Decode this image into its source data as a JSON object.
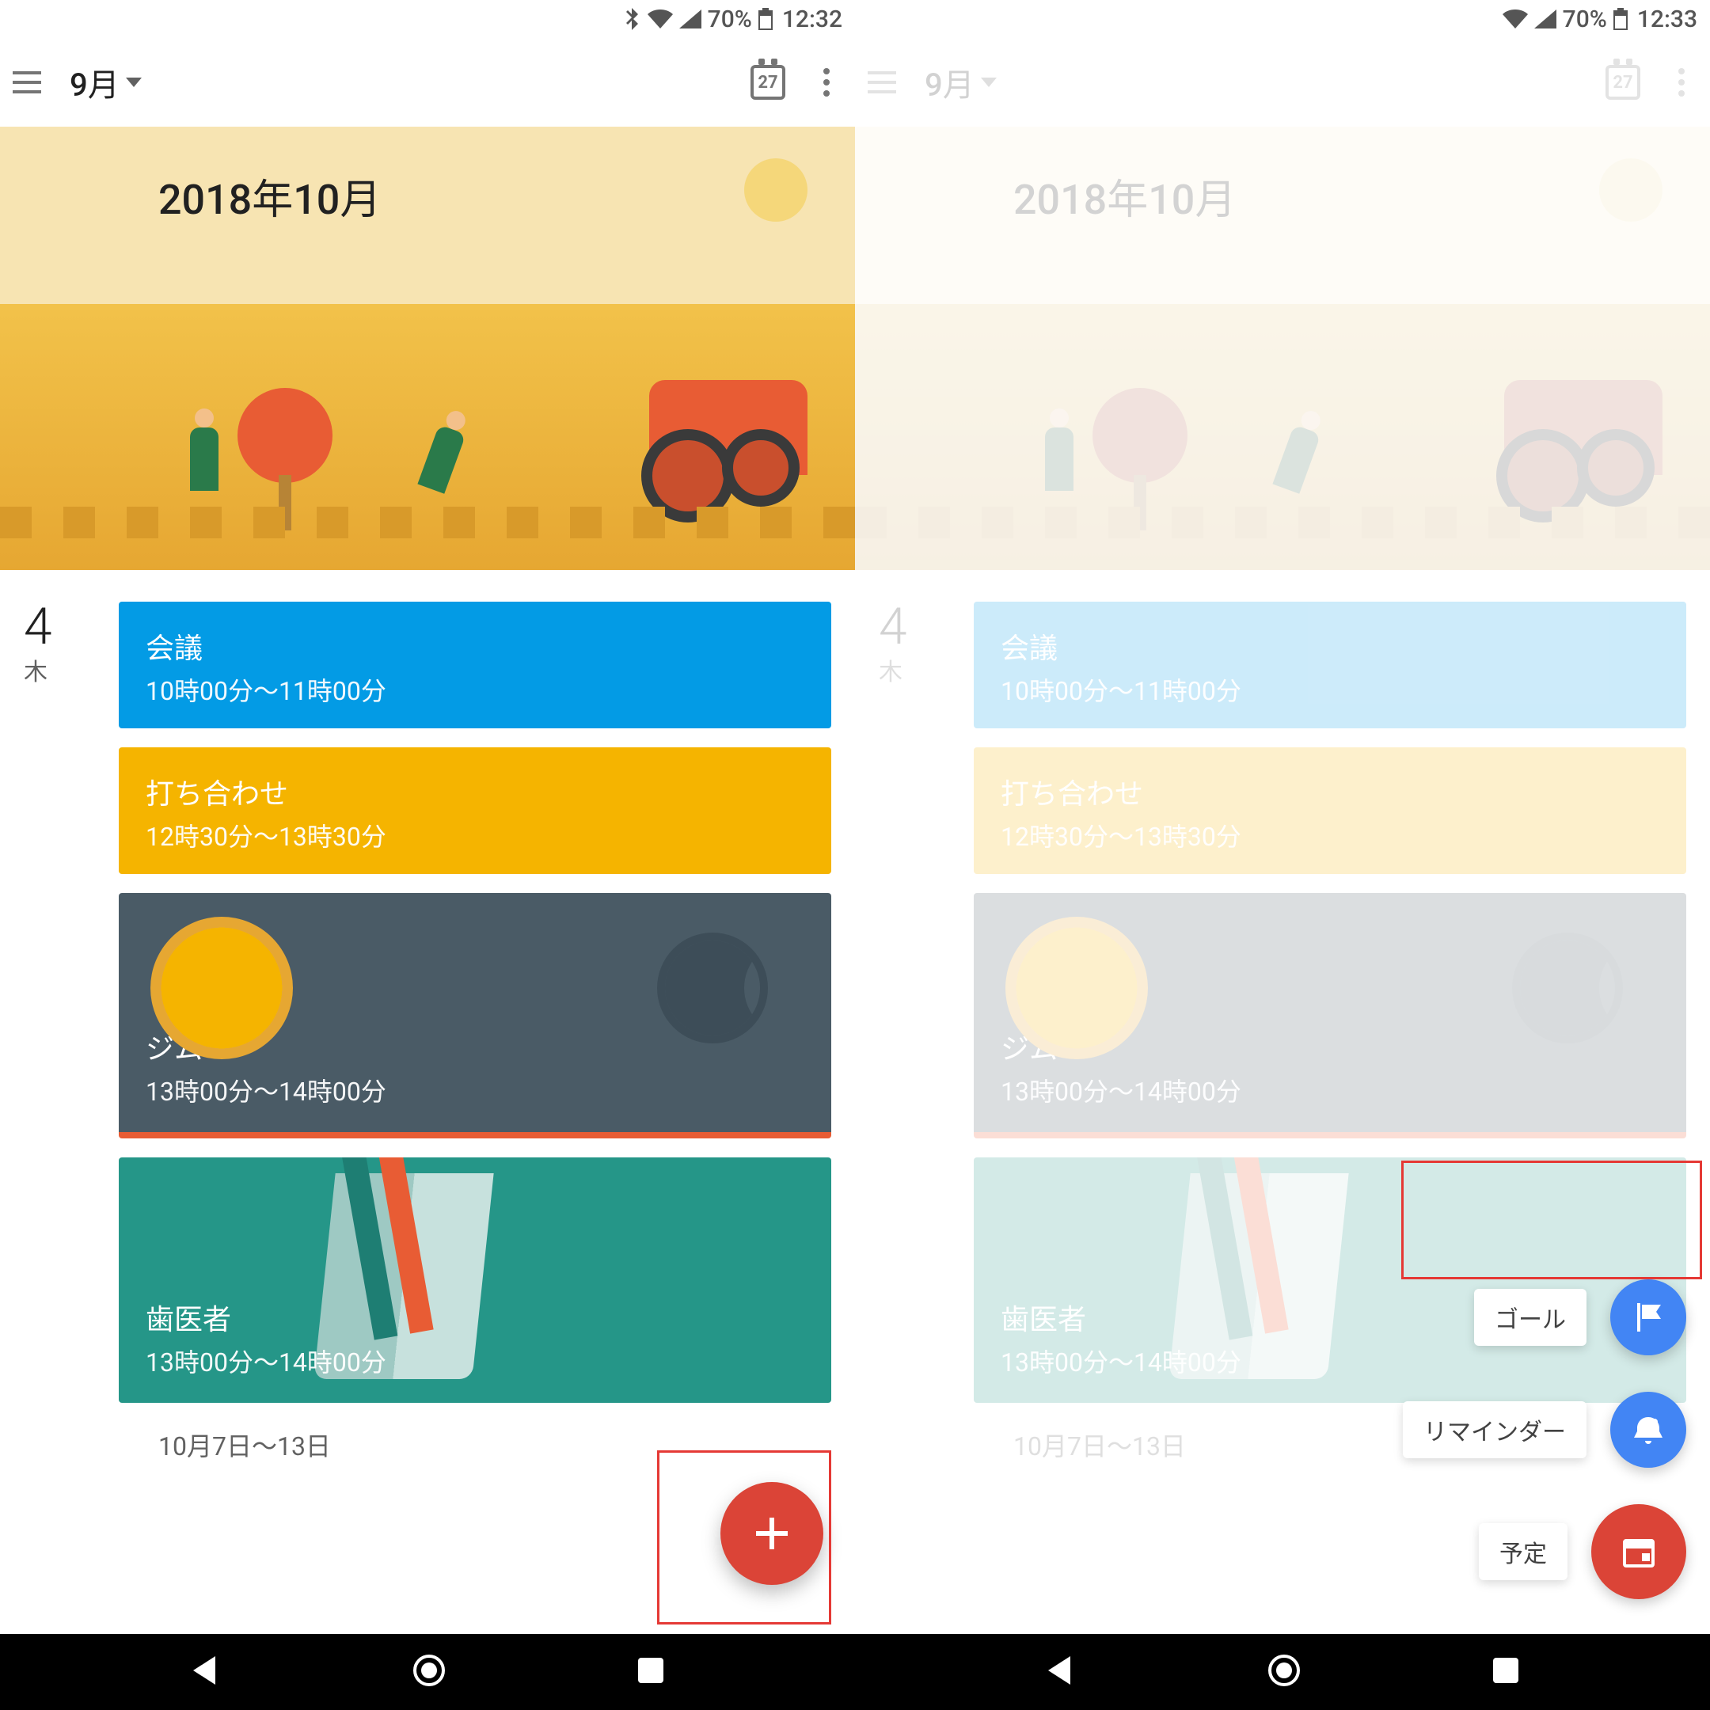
{
  "left": {
    "status": {
      "battery_pct": "70%",
      "clock": "12:32"
    },
    "appbar": {
      "month_label": "9月",
      "today_date": "27"
    },
    "month_header": {
      "title": "2018年10月"
    },
    "day": {
      "num": "4",
      "dow": "木"
    },
    "events": [
      {
        "title": "会議",
        "time": "10時00分～11時00分"
      },
      {
        "title": "打ち合わせ",
        "time": "12時30分～13時30分"
      },
      {
        "title": "ジム",
        "time": "13時00分～14時00分"
      },
      {
        "title": "歯医者",
        "time": "13時00分～14時00分"
      }
    ],
    "week_range": "10月7日～13日"
  },
  "right": {
    "status": {
      "battery_pct": "70%",
      "clock": "12:33"
    },
    "appbar": {
      "month_label": "9月",
      "today_date": "27"
    },
    "month_header": {
      "title": "2018年10月"
    },
    "day": {
      "num": "4",
      "dow": "木"
    },
    "events": [
      {
        "title": "会議",
        "time": "10時00分～11時00分"
      },
      {
        "title": "打ち合わせ",
        "time": "12時30分～13時30分"
      },
      {
        "title": "ジム",
        "time": "13時00分～14時00分"
      },
      {
        "title": "歯医者",
        "time": "13時00分～14時00分"
      }
    ],
    "week_range": "10月7日～13日",
    "speed_dial": {
      "goal_label": "ゴール",
      "reminder_label": "リマインダー",
      "event_label": "予定"
    }
  }
}
